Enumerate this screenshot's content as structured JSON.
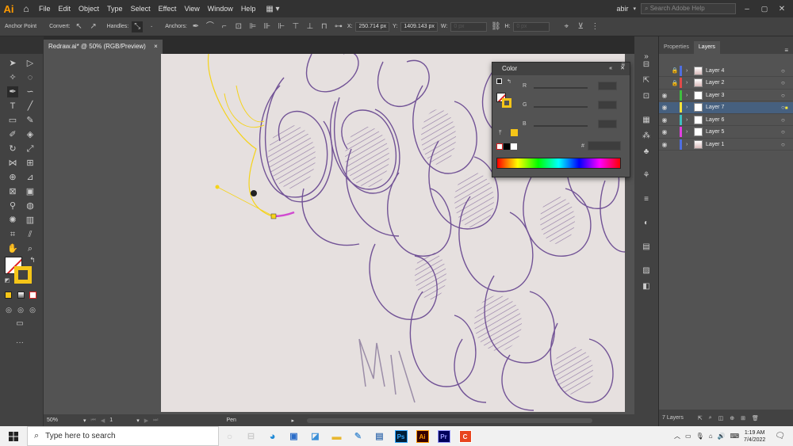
{
  "menubar": {
    "logo": "Ai",
    "items": [
      "File",
      "Edit",
      "Object",
      "Type",
      "Select",
      "Effect",
      "View",
      "Window",
      "Help"
    ],
    "user": "abir",
    "search_placeholder": "Search Adobe Help"
  },
  "controlbar": {
    "tool_label": "Anchor Point",
    "convert_label": "Convert:",
    "handles_label": "Handles:",
    "anchors_label": "Anchors:",
    "x_label": "X:",
    "x_value": "250.714 px",
    "y_label": "Y:",
    "y_value": "1409.143 px",
    "w_label": "W:",
    "w_value": "0 px",
    "h_label": "H:",
    "h_value": "0 px"
  },
  "document": {
    "tab_title": "Redraw.ai* @ 50% (RGB/Preview)",
    "close": "×"
  },
  "color_panel": {
    "title": "Color",
    "channels": [
      "R",
      "G",
      "B"
    ],
    "hex_label": "#",
    "accent": "#f5c518"
  },
  "layers_panel": {
    "tabs": [
      "Properties",
      "Layers"
    ],
    "active_tab": "Layers",
    "layers": [
      {
        "name": "Layer 4",
        "color": "#4f6ee0",
        "locked": true,
        "visible": false,
        "selected": false,
        "has_art": true
      },
      {
        "name": "Layer 2",
        "color": "#e04a4a",
        "locked": true,
        "visible": false,
        "selected": false,
        "has_art": true
      },
      {
        "name": "Layer 3",
        "color": "#3fbf3f",
        "locked": false,
        "visible": true,
        "selected": false,
        "has_art": false
      },
      {
        "name": "Layer 7",
        "color": "#f5e23a",
        "locked": false,
        "visible": true,
        "selected": true,
        "has_art": false
      },
      {
        "name": "Layer 6",
        "color": "#3fbfbf",
        "locked": false,
        "visible": true,
        "selected": false,
        "has_art": false
      },
      {
        "name": "Layer 5",
        "color": "#e03fe0",
        "locked": false,
        "visible": true,
        "selected": false,
        "has_art": false
      },
      {
        "name": "Layer 1",
        "color": "#4f6ee0",
        "locked": false,
        "visible": true,
        "selected": false,
        "has_art": true
      }
    ],
    "footer_count": "7 Layers"
  },
  "statusbar": {
    "zoom": "50%",
    "artboard_num": "1",
    "tool_name": "Pen"
  },
  "taskbar": {
    "search_placeholder": "Type here to search",
    "time": "1:19 AM",
    "date": "7/4/2022",
    "apps": [
      {
        "name": "ps",
        "label": "Ps",
        "color": "#31a8ff",
        "bg": "#001e36"
      },
      {
        "name": "ai",
        "label": "Ai",
        "color": "#ff9a00",
        "bg": "#330000"
      },
      {
        "name": "pr",
        "label": "Pr",
        "color": "#9999ff",
        "bg": "#00005b"
      },
      {
        "name": "canva",
        "label": "C",
        "color": "#ffffff",
        "bg": "#e8461f"
      }
    ]
  }
}
